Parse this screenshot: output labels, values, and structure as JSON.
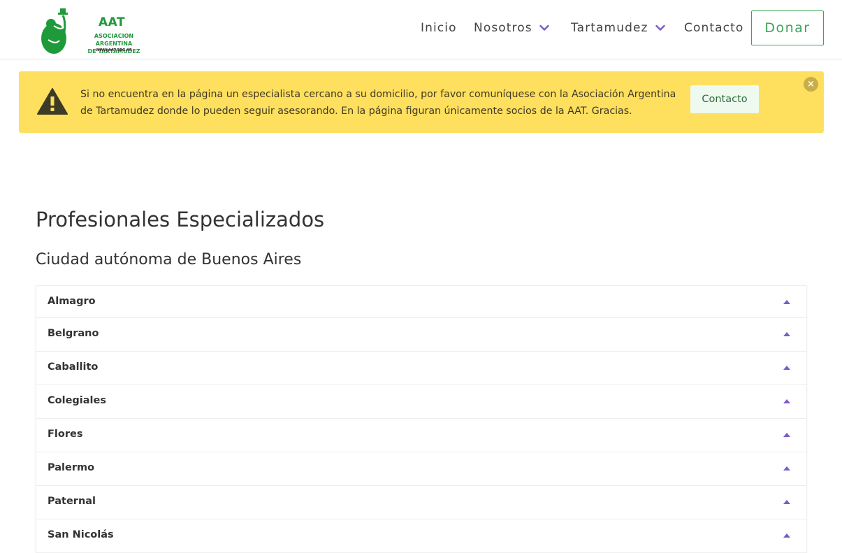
{
  "header": {
    "logo": {
      "title": "AAT",
      "subtitle_line1": "ASOCIACION ARGENTINA",
      "subtitle_line2": "DE TARTAMUDEZ",
      "url": "WWW.AAT.ORG.AR"
    },
    "nav": {
      "inicio": "Inicio",
      "nosotros": "Nosotros",
      "tartamudez": "Tartamudez",
      "contacto": "Contacto"
    },
    "donate_label": "Donar"
  },
  "alert": {
    "text": "Si no encuentra en la página un especialista cercano a su domicilio, por favor comuníquese con la Asociación Argentina de Tartamudez donde lo pueden seguir asesorando. En la página figuran únicamente socios de la AAT. Gracias.",
    "button_label": "Contacto",
    "close_symbol": "×",
    "icon": "warning-triangle-icon"
  },
  "main": {
    "title": "Profesionales Especializados",
    "region": "Ciudad autónoma de Buenos Aires",
    "neighborhoods": [
      {
        "label": "Almagro"
      },
      {
        "label": "Belgrano"
      },
      {
        "label": "Caballito"
      },
      {
        "label": "Colegiales"
      },
      {
        "label": "Flores"
      },
      {
        "label": "Palermo"
      },
      {
        "label": "Paternal"
      },
      {
        "label": "San Nicolás"
      }
    ]
  },
  "colors": {
    "brand_green": "#1f9a3a",
    "alert_yellow": "#ffdf5e",
    "accent_purple": "#7b5cc7"
  }
}
